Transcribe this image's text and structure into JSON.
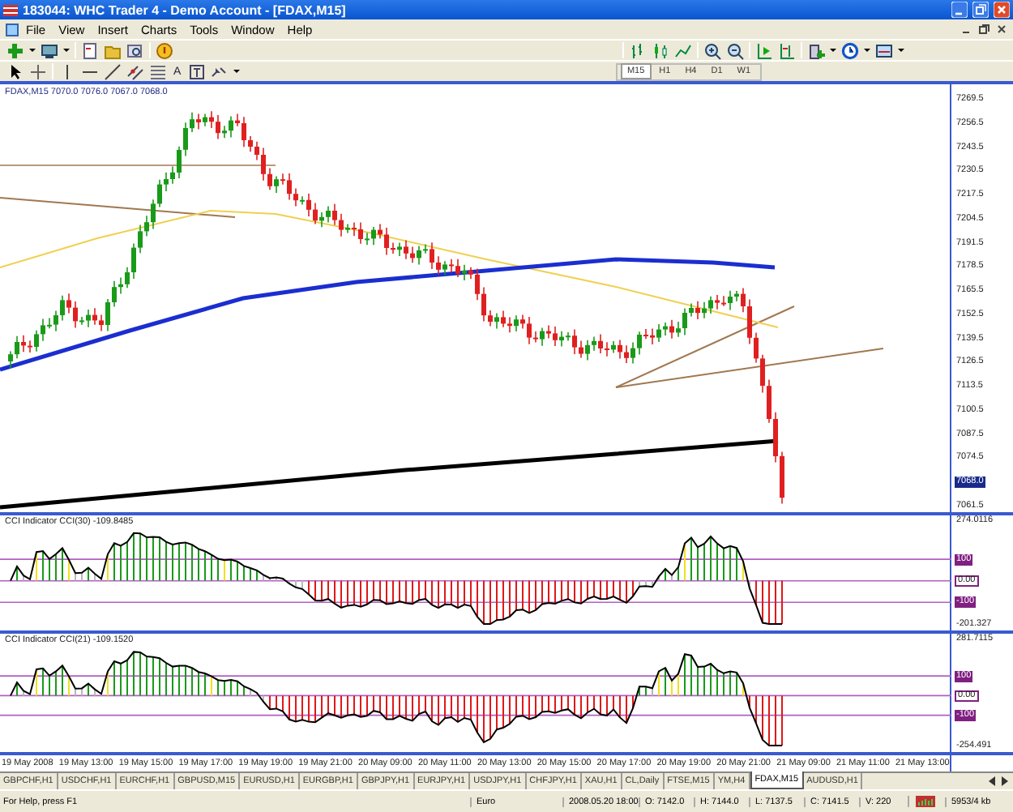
{
  "window": {
    "title": "183044: WHC Trader 4 - Demo Account - [FDAX,M15]"
  },
  "menu": [
    "File",
    "View",
    "Insert",
    "Charts",
    "Tools",
    "Window",
    "Help"
  ],
  "toolbar": {
    "text_tool_glyph": "A",
    "timeframes": [
      {
        "label": "M15",
        "selected": true
      },
      {
        "label": "H1",
        "selected": false
      },
      {
        "label": "H4",
        "selected": false
      },
      {
        "label": "D1",
        "selected": false
      },
      {
        "label": "W1",
        "selected": false
      }
    ]
  },
  "chart": {
    "header": "FDAX,M15  7070.0 7076.0 7067.0 7068.0",
    "price_axis": [
      {
        "text": "7269.5",
        "current": false
      },
      {
        "text": "7256.5",
        "current": false
      },
      {
        "text": "7243.5",
        "current": false
      },
      {
        "text": "7230.5",
        "current": false
      },
      {
        "text": "7217.5",
        "current": false
      },
      {
        "text": "7204.5",
        "current": false
      },
      {
        "text": "7191.5",
        "current": false
      },
      {
        "text": "7178.5",
        "current": false
      },
      {
        "text": "7165.5",
        "current": false
      },
      {
        "text": "7152.5",
        "current": false
      },
      {
        "text": "7139.5",
        "current": false
      },
      {
        "text": "7126.5",
        "current": false
      },
      {
        "text": "7113.5",
        "current": false
      },
      {
        "text": "7100.5",
        "current": false
      },
      {
        "text": "7087.5",
        "current": false
      },
      {
        "text": "7074.5",
        "current": false
      },
      {
        "text": "7068.0",
        "current": true
      },
      {
        "text": "7061.5",
        "current": false
      }
    ]
  },
  "indicators": [
    {
      "label": "CCI Indicator  CCI(30) -109.8485",
      "axis": [
        {
          "text": "274.0116",
          "kind": "max"
        },
        {
          "text": "100",
          "kind": "upper"
        },
        {
          "text": "0.00",
          "kind": "zero"
        },
        {
          "text": "-100",
          "kind": "lower"
        },
        {
          "text": "-201.327",
          "kind": "min"
        }
      ]
    },
    {
      "label": "CCI Indicator  CCI(21) -109.1520",
      "axis": [
        {
          "text": "281.7115",
          "kind": "max"
        },
        {
          "text": "100",
          "kind": "upper"
        },
        {
          "text": "0.00",
          "kind": "zero"
        },
        {
          "text": "-100",
          "kind": "lower"
        },
        {
          "text": "-254.491",
          "kind": "min"
        }
      ]
    }
  ],
  "time_axis": [
    "19 May 2008",
    "19 May 13:00",
    "19 May 15:00",
    "19 May 17:00",
    "19 May 19:00",
    "19 May 21:00",
    "20 May 09:00",
    "20 May 11:00",
    "20 May 13:00",
    "20 May 15:00",
    "20 May 17:00",
    "20 May 19:00",
    "20 May 21:00",
    "21 May 09:00",
    "21 May 11:00",
    "21 May 13:00"
  ],
  "tabs": [
    {
      "label": "GBPCHF,H1",
      "selected": false
    },
    {
      "label": "USDCHF,H1",
      "selected": false
    },
    {
      "label": "EURCHF,H1",
      "selected": false
    },
    {
      "label": "GBPUSD,M15",
      "selected": false
    },
    {
      "label": "EURUSD,H1",
      "selected": false
    },
    {
      "label": "EURGBP,H1",
      "selected": false
    },
    {
      "label": "GBPJPY,H1",
      "selected": false
    },
    {
      "label": "EURJPY,H1",
      "selected": false
    },
    {
      "label": "USDJPY,H1",
      "selected": false
    },
    {
      "label": "CHFJPY,H1",
      "selected": false
    },
    {
      "label": "XAU,H1",
      "selected": false
    },
    {
      "label": "CL,Daily",
      "selected": false
    },
    {
      "label": "FTSE,M15",
      "selected": false
    },
    {
      "label": "YM,H4",
      "selected": false
    },
    {
      "label": "FDAX,M15",
      "selected": true
    },
    {
      "label": "AUDUSD,H1",
      "selected": false
    }
  ],
  "status_bar": {
    "help": "For Help, press F1",
    "profile": "Euro",
    "time": "2008.05.20 18:00",
    "open": "O: 7142.0",
    "high": "H: 7144.0",
    "low": "L: 7137.5",
    "close": "C: 7141.5",
    "volume": "V: 220",
    "traffic": "5953/4 kb"
  }
}
